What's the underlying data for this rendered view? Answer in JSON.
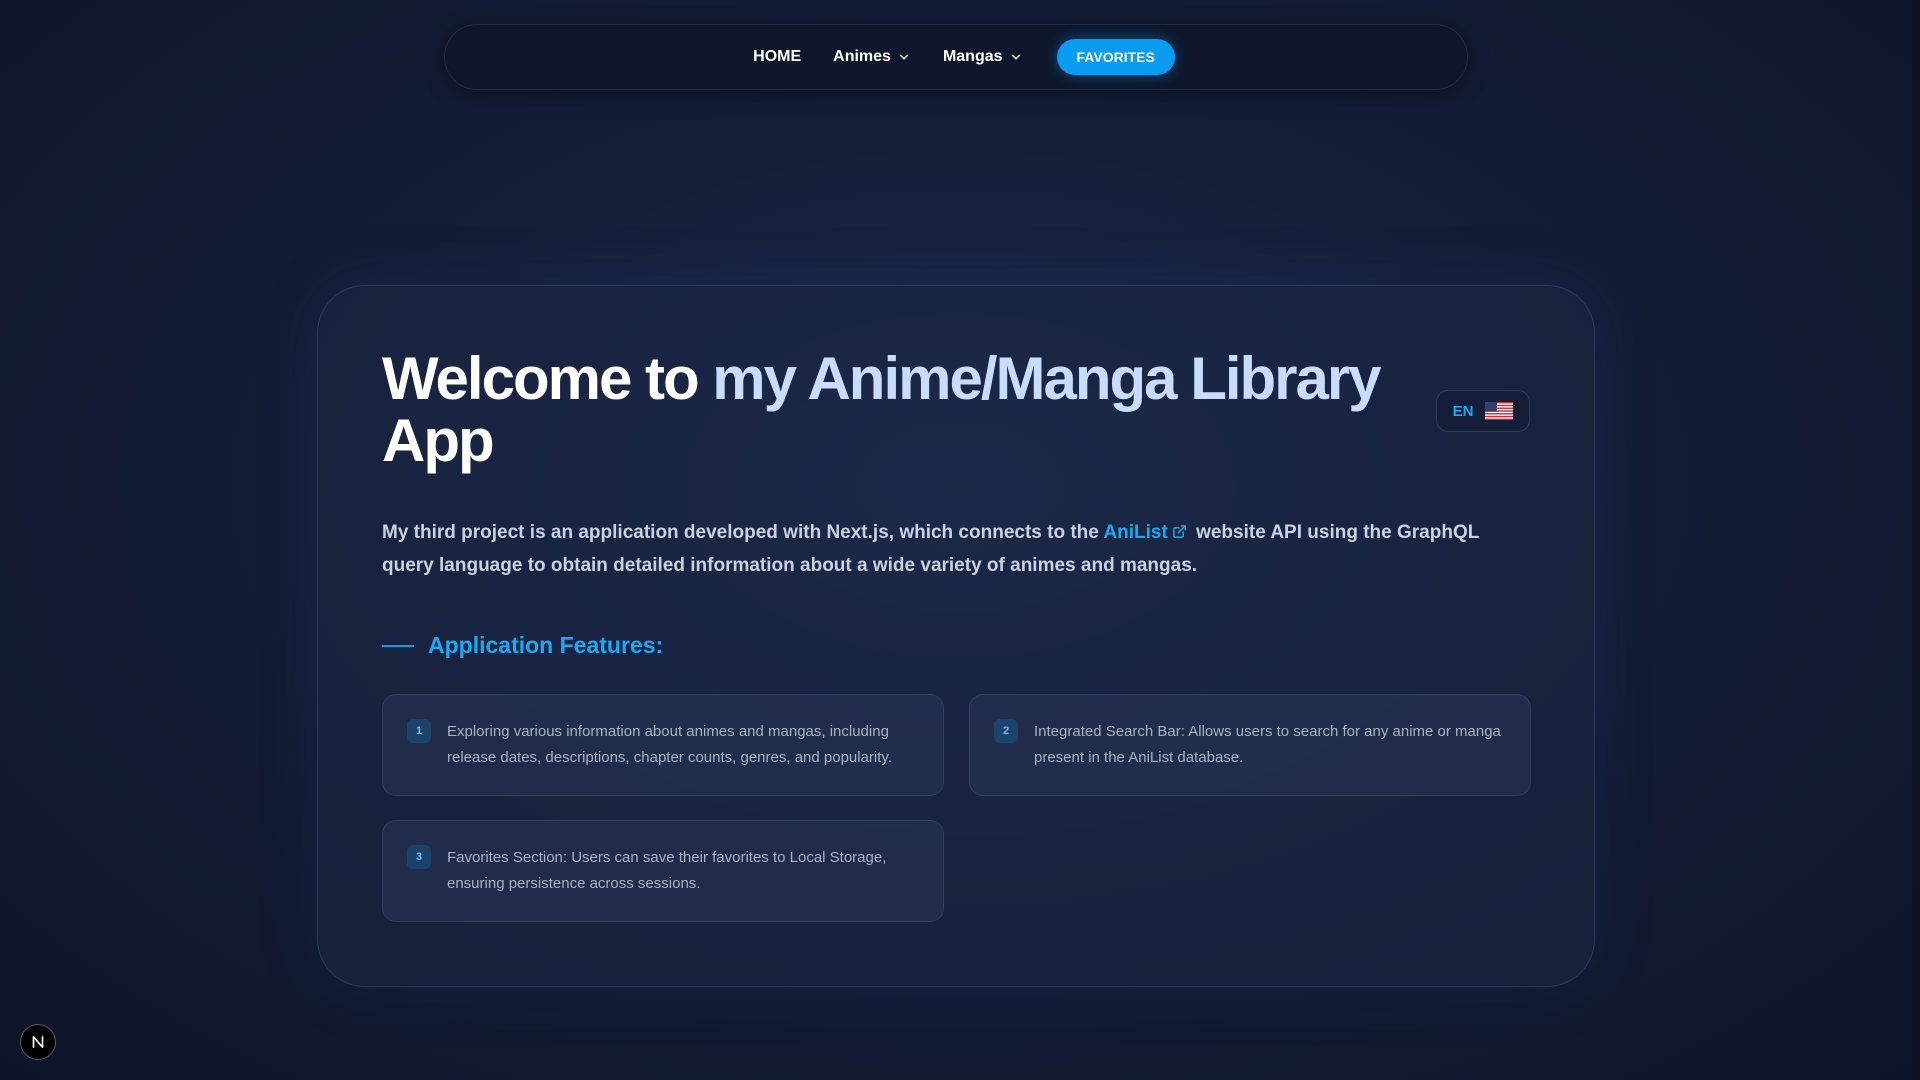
{
  "nav": {
    "home": "HOME",
    "animes": "Animes",
    "mangas": "Mangas",
    "favorites": "FAVORITES"
  },
  "hero": {
    "title_part1": "Welcome to ",
    "title_part2": "my Anime/Manga Library",
    "title_part3": "App"
  },
  "language": {
    "code": "EN",
    "flag_icon": "us-flag-icon"
  },
  "description": {
    "before_link": "My third project is an application developed with Next.js, which connects to the ",
    "link_text": "AniList",
    "after_link": " website API using the GraphQL query language to obtain detailed information about a wide variety of animes and mangas."
  },
  "features": {
    "heading": "Application Features:",
    "items": [
      {
        "number": "1",
        "text": "Exploring various information about animes and mangas, including release dates, descriptions, chapter counts, genres, and popularity."
      },
      {
        "number": "2",
        "text": "Integrated Search Bar: Allows users to search for any anime or manga present in the AniList database."
      },
      {
        "number": "3",
        "text": "Favorites Section: Users can save their favorites to Local Storage, ensuring persistence across sessions."
      }
    ]
  },
  "badge": {
    "letter": "N"
  },
  "colors": {
    "accent": "#0a9cf0",
    "link": "#1aa9f5",
    "background": "#141e38"
  }
}
